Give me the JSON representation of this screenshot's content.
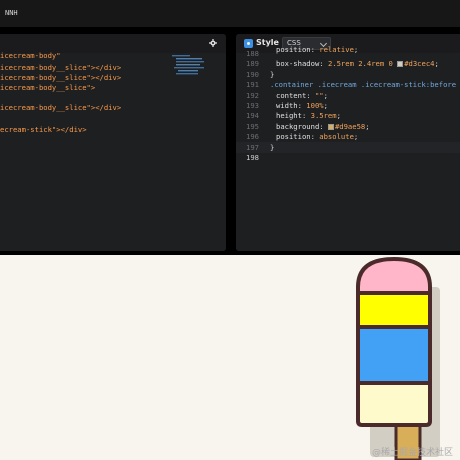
{
  "topbar": {
    "logo_text": "NNH"
  },
  "html_panel": {
    "lines": [
      {
        "text": "icecream-body\"",
        "kind": "partial"
      },
      {
        "text": "icecream-body__slice\"></div>",
        "kind": "slice"
      },
      {
        "text": "icecream-body__slice\"></div>",
        "kind": "slice"
      },
      {
        "text": "icecream-body__slice\">",
        "kind": "slice"
      },
      {
        "text": "",
        "kind": "blank"
      },
      {
        "text": "icecream-body__slice\"></div>",
        "kind": "slice"
      },
      {
        "text": "",
        "kind": "blank"
      },
      {
        "text": "ecream-stick\"></div>",
        "kind": "stick"
      }
    ]
  },
  "css_panel": {
    "title": "Style",
    "language": "CSS",
    "line_numbers": [
      "188",
      "189",
      "190",
      "191",
      "192",
      "193",
      "194",
      "195",
      "196",
      "197",
      "198"
    ],
    "lines": [
      {
        "prop": "position",
        "value": "relative"
      },
      {
        "prop": "box-shadow",
        "value": "2.5rem 2.4rem 0",
        "color": "#d3cec4"
      },
      {
        "text": "}"
      },
      {
        "selector": ".container .icecream .icecream-stick:before {"
      },
      {
        "prop": "content",
        "value": "\"\""
      },
      {
        "prop": "width",
        "value": "100%"
      },
      {
        "prop": "height",
        "value": "3.5rem"
      },
      {
        "prop": "background",
        "value": "",
        "color": "#d9ae58"
      },
      {
        "prop": "position",
        "value": "absolute"
      },
      {
        "text": "}"
      },
      {
        "text": ""
      }
    ]
  },
  "preview": {
    "watermark": "@稀土掘金技术社区",
    "colors": {
      "outline": "#4a2a2a",
      "top": "#ffb6c8",
      "yellow": "#ffff00",
      "blue": "#42a0f5",
      "cream": "#fffacc",
      "stick": "#d9ae58",
      "shadow": "#d3cec4"
    }
  }
}
